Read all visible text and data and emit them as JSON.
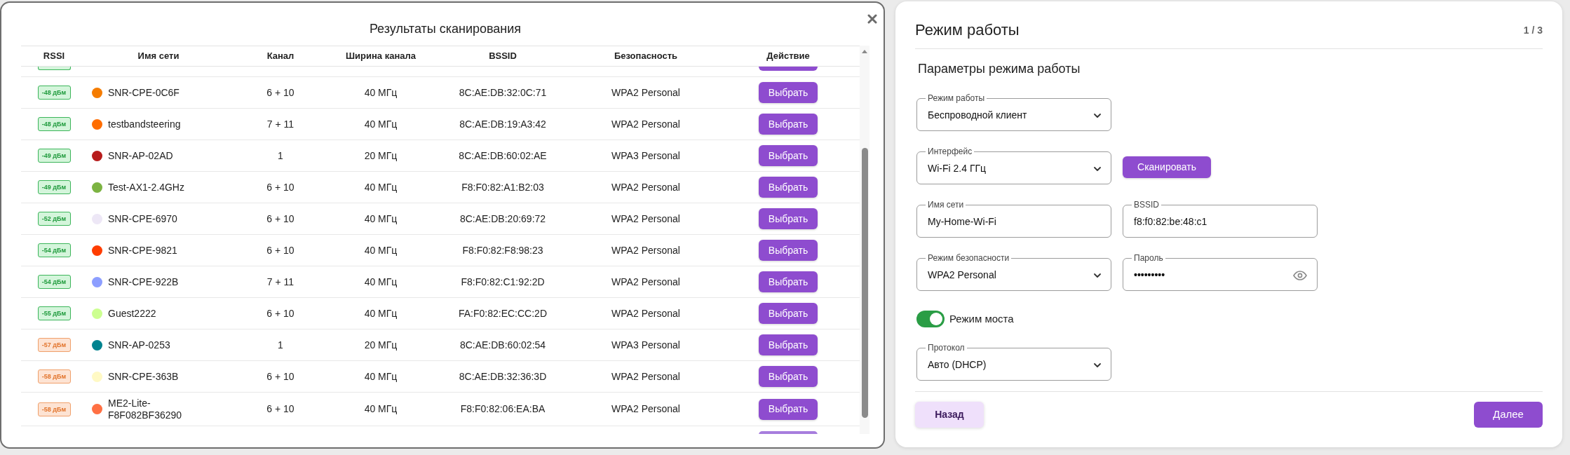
{
  "scan_dialog": {
    "title": "Результаты сканирования",
    "columns": [
      "RSSI",
      "Имя сети",
      "Канал",
      "Ширина канала",
      "BSSID",
      "Безопасность",
      "Действие"
    ],
    "rows": [
      {
        "rssi": "-48 дБм",
        "kind": "good",
        "color": "#f57c00",
        "name": "SNR-CPE-0C6F",
        "channel": "6 + 10",
        "width": "40 МГц",
        "bssid": "8C:AE:DB:32:0C:71",
        "security": "WPA2 Personal",
        "action": "Выбрать"
      },
      {
        "rssi": "-48 дБм",
        "kind": "good",
        "color": "#ff6d00",
        "name": "testbandsteering",
        "channel": "7 + 11",
        "width": "40 МГц",
        "bssid": "8C:AE:DB:19:A3:42",
        "security": "WPA2 Personal",
        "action": "Выбрать"
      },
      {
        "rssi": "-49 дБм",
        "kind": "good",
        "color": "#b71c1c",
        "name": "SNR-AP-02AD",
        "channel": "1",
        "width": "20 МГц",
        "bssid": "8C:AE:DB:60:02:AE",
        "security": "WPA3 Personal",
        "action": "Выбрать"
      },
      {
        "rssi": "-49 дБм",
        "kind": "good",
        "color": "#7cb342",
        "name": "Test-AX1-2.4GHz",
        "channel": "6 + 10",
        "width": "40 МГц",
        "bssid": "F8:F0:82:A1:B2:03",
        "security": "WPA2 Personal",
        "action": "Выбрать"
      },
      {
        "rssi": "-52 дБм",
        "kind": "good",
        "color": "#ede7f6",
        "name": "SNR-CPE-6970",
        "channel": "6 + 10",
        "width": "40 МГц",
        "bssid": "8C:AE:DB:20:69:72",
        "security": "WPA2 Personal",
        "action": "Выбрать"
      },
      {
        "rssi": "-54 дБм",
        "kind": "good",
        "color": "#ff3d00",
        "name": "SNR-CPE-9821",
        "channel": "6 + 10",
        "width": "40 МГц",
        "bssid": "F8:F0:82:F8:98:23",
        "security": "WPA2 Personal",
        "action": "Выбрать"
      },
      {
        "rssi": "-54 дБм",
        "kind": "good",
        "color": "#8c9eff",
        "name": "SNR-CPE-922B",
        "channel": "7 + 11",
        "width": "40 МГц",
        "bssid": "F8:F0:82:C1:92:2D",
        "security": "WPA2 Personal",
        "action": "Выбрать"
      },
      {
        "rssi": "-55 дБм",
        "kind": "good",
        "color": "#ccff90",
        "name": "Guest2222",
        "channel": "6 + 10",
        "width": "40 МГц",
        "bssid": "FA:F0:82:EC:CC:2D",
        "security": "WPA2 Personal",
        "action": "Выбрать"
      },
      {
        "rssi": "-57 дБм",
        "kind": "fair",
        "color": "#00838f",
        "name": "SNR-AP-0253",
        "channel": "1",
        "width": "20 МГц",
        "bssid": "8C:AE:DB:60:02:54",
        "security": "WPA3 Personal",
        "action": "Выбрать"
      },
      {
        "rssi": "-58 дБм",
        "kind": "fair",
        "color": "#fff9c4",
        "name": "SNR-CPE-363B",
        "channel": "6 + 10",
        "width": "40 МГц",
        "bssid": "8C:AE:DB:32:36:3D",
        "security": "WPA2 Personal",
        "action": "Выбрать"
      },
      {
        "rssi": "-58 дБм",
        "kind": "fair",
        "color": "#ff7043",
        "name": "ME2-Lite-F8F082BF36290",
        "channel": "6 + 10",
        "width": "40 МГц",
        "bssid": "F8:F0:82:06:EA:BA",
        "security": "WPA2 Personal",
        "action": "Выбрать"
      }
    ]
  },
  "wizard": {
    "title": "Режим работы",
    "step": "1 / 3",
    "section_title": "Параметры режима работы",
    "form_rows": [
      {
        "fields": [
          {
            "kind": "select",
            "label": "Режим работы",
            "value": "Беспроводной клиент"
          }
        ]
      },
      {
        "fields": [
          {
            "kind": "select",
            "label": "Интерфейс",
            "value": "Wi-Fi 2.4 ГГц"
          },
          {
            "kind": "button",
            "label": "Сканировать"
          }
        ]
      },
      {
        "fields": [
          {
            "kind": "input",
            "label": "Имя сети",
            "value": "My-Home-Wi-Fi"
          },
          {
            "kind": "input",
            "label": "BSSID",
            "value": "f8:f0:82:be:48:c1"
          }
        ]
      },
      {
        "fields": [
          {
            "kind": "select",
            "label": "Режим безопасности",
            "value": "WPA2 Personal"
          },
          {
            "kind": "password",
            "label": "Пароль",
            "value": "•••••••••"
          }
        ]
      },
      {
        "fields": [
          {
            "kind": "switch",
            "label": "Режим моста",
            "on": true
          }
        ]
      },
      {
        "fields": [
          {
            "kind": "select",
            "label": "Протокол",
            "value": "Авто (DHCP)"
          }
        ]
      }
    ],
    "back": "Назад",
    "next": "Далее"
  }
}
